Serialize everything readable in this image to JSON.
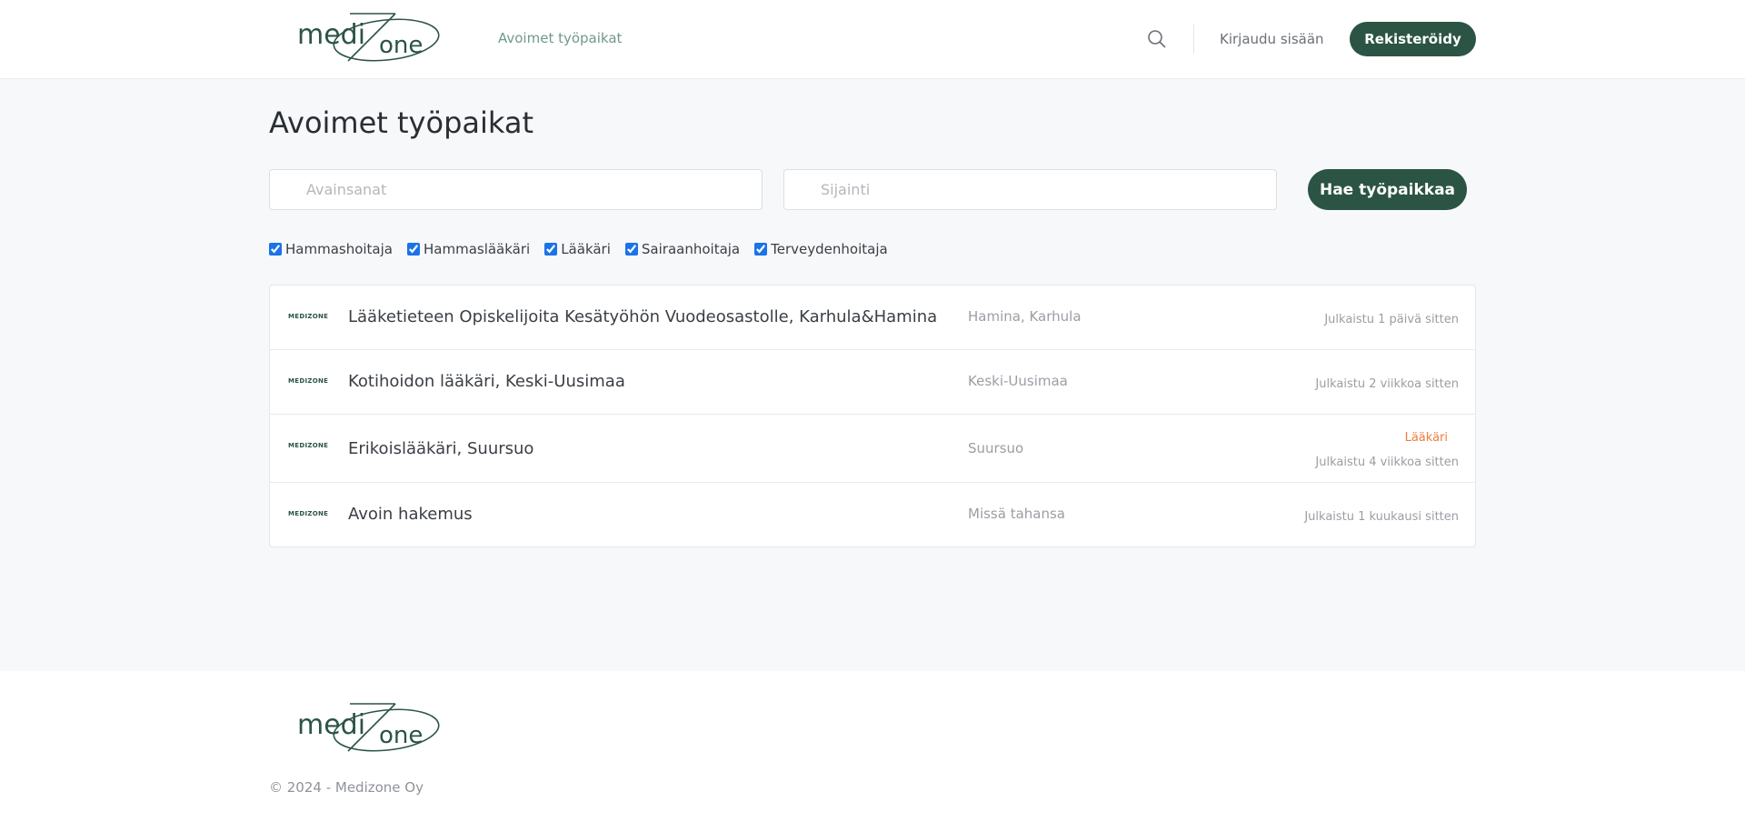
{
  "brand": {
    "logo_text": "medizone",
    "mini_logo_text": "MEDIZONE",
    "color": "#2b5445"
  },
  "header": {
    "nav_link": "Avoimet työpaikat",
    "search_icon": "search-icon",
    "login_label": "Kirjaudu sisään",
    "register_label": "Rekisteröidy"
  },
  "main": {
    "title": "Avoimet työpaikat",
    "keywords_placeholder": "Avainsanat",
    "location_placeholder": "Sijainti",
    "search_button": "Hae työpaikkaa",
    "filters": [
      {
        "label": "Hammashoitaja",
        "checked": true
      },
      {
        "label": "Hammaslääkäri",
        "checked": true
      },
      {
        "label": "Lääkäri",
        "checked": true
      },
      {
        "label": "Sairaanhoitaja",
        "checked": true
      },
      {
        "label": "Terveydenhoitaja",
        "checked": true
      }
    ],
    "jobs": [
      {
        "title": "Lääketieteen Opiskelijoita Kesätyöhön Vuodeosastolle, Karhula&Hamina",
        "place": "Hamina, Karhula",
        "tag": "",
        "date": "Julkaistu 1 päivä sitten"
      },
      {
        "title": "Kotihoidon lääkäri, Keski-Uusimaa",
        "place": "Keski-Uusimaa",
        "tag": "",
        "date": "Julkaistu 2 viikkoa sitten"
      },
      {
        "title": "Erikoislääkäri, Suursuo",
        "place": "Suursuo",
        "tag": "Lääkäri",
        "date": "Julkaistu 4 viikkoa sitten"
      },
      {
        "title": "Avoin hakemus",
        "place": "Missä tahansa",
        "tag": "",
        "date": "Julkaistu 1 kuukausi sitten"
      }
    ],
    "tag_color": "#ef7d3c"
  },
  "footer": {
    "copyright": "© 2024 - Medizone Oy"
  }
}
